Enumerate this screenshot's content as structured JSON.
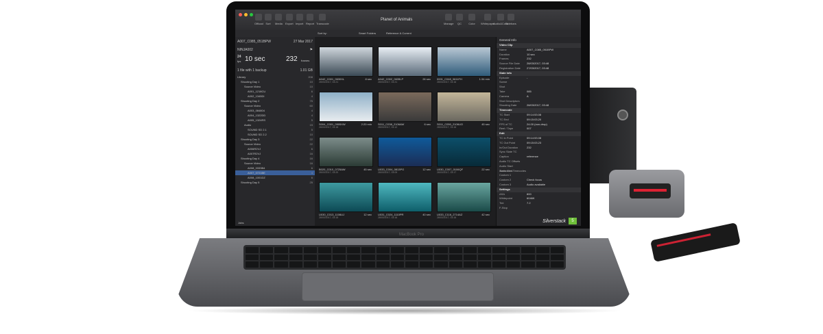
{
  "window": {
    "title": "Planet of Animals"
  },
  "toolbar": {
    "left": [
      "Offload",
      "Sort",
      "Media",
      "Export",
      "Import",
      "Report",
      "Transcode"
    ],
    "right": [
      "Manage",
      "QC",
      "Color",
      "Whitepaper",
      "Audio&Color",
      "Sidebars"
    ]
  },
  "subbar": {
    "sort_by": "Sort by:",
    "smart_folders": "Smart Folders",
    "reference": "Reference & Current"
  },
  "clip_header": {
    "name": "A007_C085_051BPW",
    "date": "27 Mar 2017",
    "source": "NINJA002",
    "fps_top": "24",
    "fps_bottom": "fps",
    "duration": "10 sec",
    "frames": "232",
    "frames_label": "frames",
    "backup_text": "1 file with 1 backup",
    "size": "1.01 GB"
  },
  "library": [
    {
      "label": "Library",
      "count": "208"
    },
    {
      "label": "Shooting Day 1",
      "count": "10"
    },
    {
      "label": "Source Video",
      "count": "10"
    },
    {
      "label": "A001_1218CU",
      "count": "6"
    },
    {
      "label": "A002_1345DI",
      "count": "4"
    },
    {
      "label": "Shooting Day 2",
      "count": "75"
    },
    {
      "label": "Source Video",
      "count": "60"
    },
    {
      "label": "A003_084804",
      "count": "4"
    },
    {
      "label": "A004_1322DD",
      "count": "4"
    },
    {
      "label": "A005_1324RS",
      "count": "5"
    },
    {
      "label": "Audio",
      "count": "15"
    },
    {
      "label": "SOUND SD 2.1",
      "count": "5"
    },
    {
      "label": "SOUND SD 2.2",
      "count": "10"
    },
    {
      "label": "Shooting Day 3",
      "count": "22"
    },
    {
      "label": "Source Video",
      "count": "22"
    },
    {
      "label": "A006R2VJ",
      "count": "6"
    },
    {
      "label": "A007R2VJ",
      "count": "16"
    },
    {
      "label": "Shooting Day 4",
      "count": "16"
    },
    {
      "label": "Source Video",
      "count": "16"
    },
    {
      "label": "A008_0333B4",
      "count": "6"
    },
    {
      "label": "A007_0721BE",
      "count": "4"
    },
    {
      "label": "A008_1001DZ",
      "count": "6"
    },
    {
      "label": "Shooting Day 5",
      "count": "25"
    }
  ],
  "left_footer": "Jobs",
  "thumbs": [
    {
      "name": "A042_C001_0630XL",
      "dur": "8 sec",
      "date": "28/03/2017, 03:21",
      "c1": "#cfd6dc",
      "c2": "#3b4a55"
    },
    {
      "name": "A042_C002_0635LP",
      "dur": "26 sec",
      "date": "28/03/2017, 03:21",
      "c1": "#e8eef4",
      "c2": "#5a6a79"
    },
    {
      "name": "0001_C048_0611FH",
      "dur": "1:34 min",
      "date": "28/03/2017, 03:16",
      "c1": "#b9c8d4",
      "c2": "#2f5b7a"
    },
    {
      "name": "S004_C001_0905XW",
      "dur": "2:20 min",
      "date": "28/03/2017, 03:18",
      "c1": "#8fb0c8",
      "c2": "#e8ecef"
    },
    {
      "name": "S011_C038_2106AW",
      "dur": "6 sec",
      "date": "28/03/2017, 03:12",
      "c1": "#7b6a5c",
      "c2": "#3a3a3a"
    },
    {
      "name": "S011_C050_2106UO",
      "dur": "45 sec",
      "date": "28/03/2017, 03:16",
      "c1": "#c4b69a",
      "c2": "#6a6860"
    },
    {
      "name": "B020_C010_0725AW",
      "dur": "45 sec",
      "date": "28/03/2017, 03:20",
      "c1": "#7c8c8a",
      "c2": "#2b3b35"
    },
    {
      "name": "U033_C004_0813PG",
      "dur": "12 sec",
      "date": "28/03/2017, 03:09",
      "c1": "#0f5a9a",
      "c2": "#1b2d55"
    },
    {
      "name": "U030_C007_0106QF",
      "dur": "22 sec",
      "date": "28/03/2017, 03:17",
      "c1": "#0c4f6a",
      "c2": "#082a38"
    },
    {
      "name": "U030_C013_1106UJ",
      "dur": "12 sec",
      "date": "28/03/2017, 03:15",
      "c1": "#3e9aa0",
      "c2": "#0d4a55"
    },
    {
      "name": "U031_C024_1110PR",
      "dur": "40 sec",
      "date": "28/03/2017, 03:16",
      "c1": "#4fb8c0",
      "c2": "#0e5e6a"
    },
    {
      "name": "U033_C116_2714AZ",
      "dur": "42 sec",
      "date": "28/03/2017, 03:16",
      "c1": "#6aa6a0",
      "c2": "#1a4a48"
    }
  ],
  "inspector": {
    "title": "General Info",
    "sections": [
      {
        "name": "Video Clip",
        "rows": [
          [
            "Name",
            "A007_C085_051BPW"
          ],
          [
            "Duration",
            "10 sec"
          ],
          [
            "Frames",
            "232"
          ],
          [
            "Source File Date",
            "28/03/2017, 03:48"
          ],
          [
            "Registration Date",
            "27/03/2017, 03:48"
          ]
        ]
      },
      {
        "name": "Slate Info",
        "rows": [
          [
            "Episode",
            "-"
          ],
          [
            "Scene",
            ""
          ],
          [
            "Shot",
            ""
          ],
          [
            "Take",
            "085"
          ],
          [
            "Camera",
            "A"
          ],
          [
            "Shot Descriptors",
            ""
          ],
          [
            "Shooting Date",
            "28/03/2017, 03:48"
          ]
        ]
      },
      {
        "name": "Timecode",
        "rows": [
          [
            "TC Start",
            "09:14:53.08"
          ],
          [
            "TC End",
            "09:15:03.20"
          ],
          [
            "FPS of TC",
            "24.00 (non-drop)"
          ],
          [
            "Reel / Tape",
            "007"
          ]
        ]
      },
      {
        "name": "Edit",
        "rows": [
          [
            "TC In Point",
            "09:14:53.08"
          ],
          [
            "TC Out Point",
            "09:15:03.23"
          ],
          [
            "In/Out Duration",
            "232"
          ],
          [
            "Sync Slate TC",
            ""
          ],
          [
            "Caption",
            "reference"
          ],
          [
            "Audio TC Offsets",
            ""
          ],
          [
            "Audio Start Timecodes",
            ""
          ],
          [
            "Audio End Timecodes",
            ""
          ],
          [
            "Custom 1",
            ""
          ],
          [
            "Custom 2",
            "Check focus"
          ],
          [
            "Custom 3",
            "Audio available"
          ]
        ]
      },
      {
        "name": "Settings",
        "rows": [
          [
            "ASA",
            "800"
          ],
          [
            "Whitepoint",
            "6046K"
          ],
          [
            "Tint",
            "7.2"
          ],
          [
            "F-Stop",
            ""
          ]
        ]
      }
    ]
  },
  "branding": {
    "product": "Silverstack",
    "badge": "5",
    "bezel": "MacBook Pro"
  }
}
